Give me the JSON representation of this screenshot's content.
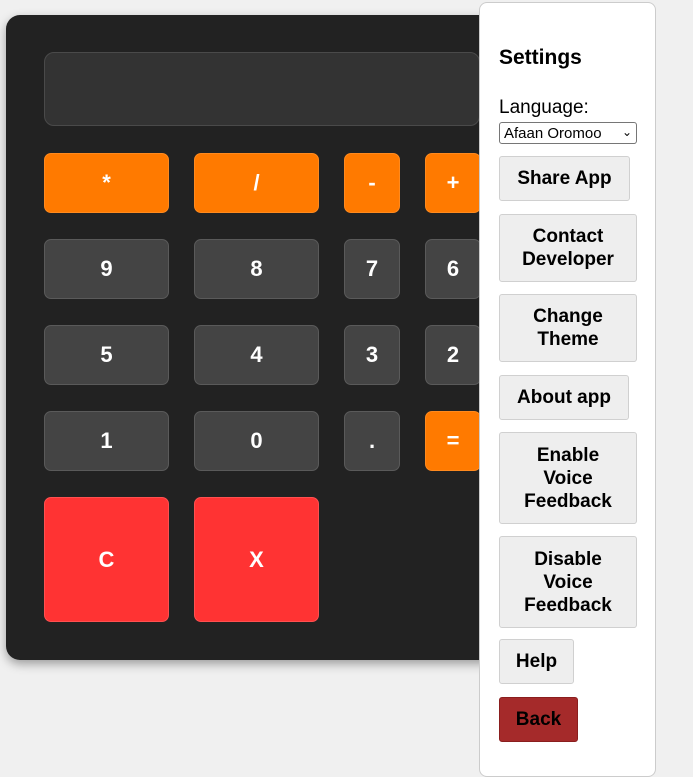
{
  "calculator": {
    "display_value": "",
    "keys": {
      "multiply": "*",
      "divide": "/",
      "minus": "-",
      "plus": "+",
      "nine": "9",
      "eight": "8",
      "seven": "7",
      "six": "6",
      "five": "5",
      "four": "4",
      "three": "3",
      "two": "2",
      "one": "1",
      "zero": "0",
      "dot": ".",
      "equals": "=",
      "clear": "C",
      "backspace": "X"
    },
    "colors": {
      "operator": "#ff7a00",
      "number": "#444444",
      "clear": "#ff3333",
      "body": "#222222"
    }
  },
  "settings": {
    "title": "Settings",
    "language_label": "Language:",
    "language_selected": "Afaan Oromoo",
    "buttons": {
      "share": "Share App",
      "contact": "Contact Developer",
      "theme": "Change Theme",
      "about": "About app",
      "enable_voice": "Enable Voice Feedback",
      "disable_voice": "Disable Voice Feedback",
      "help": "Help",
      "back": "Back"
    },
    "colors": {
      "back_button": "#a52a2a"
    }
  }
}
